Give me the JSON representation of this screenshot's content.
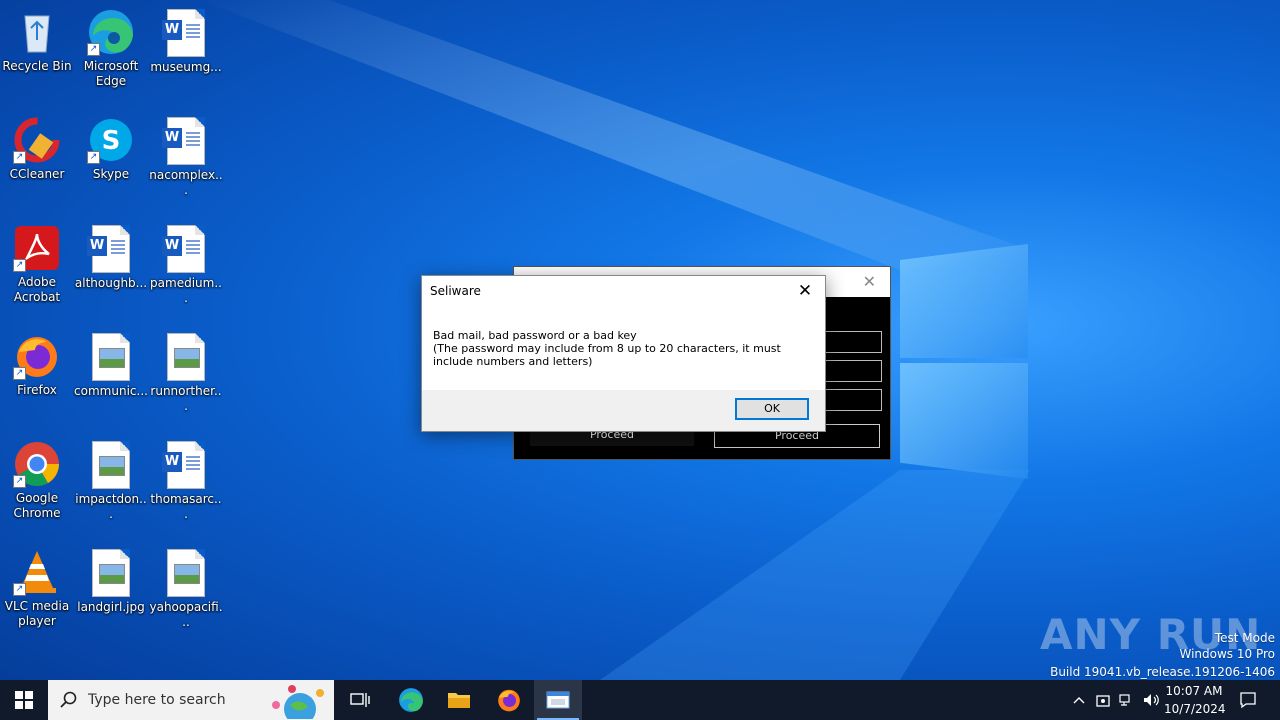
{
  "desktop": {
    "icons": [
      {
        "label": "Recycle Bin",
        "kind": "recycle-bin"
      },
      {
        "label": "Microsoft Edge",
        "kind": "edge"
      },
      {
        "label": "museumg...",
        "kind": "word-doc"
      },
      {
        "label": "CCleaner",
        "kind": "ccleaner"
      },
      {
        "label": "Skype",
        "kind": "skype"
      },
      {
        "label": "nacomplex...",
        "kind": "word-doc"
      },
      {
        "label": "Adobe Acrobat",
        "kind": "acrobat"
      },
      {
        "label": "althoughb...",
        "kind": "word-doc"
      },
      {
        "label": "pamedium...",
        "kind": "word-doc"
      },
      {
        "label": "Firefox",
        "kind": "firefox"
      },
      {
        "label": "communic...",
        "kind": "image-file"
      },
      {
        "label": "runnorther...",
        "kind": "image-file"
      },
      {
        "label": "Google Chrome",
        "kind": "chrome"
      },
      {
        "label": "impactdon...",
        "kind": "image-file"
      },
      {
        "label": "thomasarc...",
        "kind": "word-doc"
      },
      {
        "label": "VLC media player",
        "kind": "vlc"
      },
      {
        "label": "landgirl.jpg",
        "kind": "image-file"
      },
      {
        "label": "yahoopacifi...",
        "kind": "image-file"
      }
    ]
  },
  "background_window": {
    "proceed_left": "Proceed",
    "proceed_right": "Proceed"
  },
  "message_box": {
    "title": "Seliware",
    "message": "Bad mail, bad password or a bad key\n(The password may include from 8 up to 20 characters, it must include numbers and letters)",
    "ok_label": "OK"
  },
  "watermark": {
    "brand": "ANY RUN",
    "line1": "Test Mode",
    "line2": "Windows 10 Pro",
    "line3": "Build 19041.vb_release.191206-1406"
  },
  "taskbar": {
    "search_placeholder": "Type here to search",
    "time": "10:07 AM",
    "date": "10/7/2024"
  },
  "colors": {
    "accent": "#0078d7",
    "taskbar": "#101a2a"
  }
}
